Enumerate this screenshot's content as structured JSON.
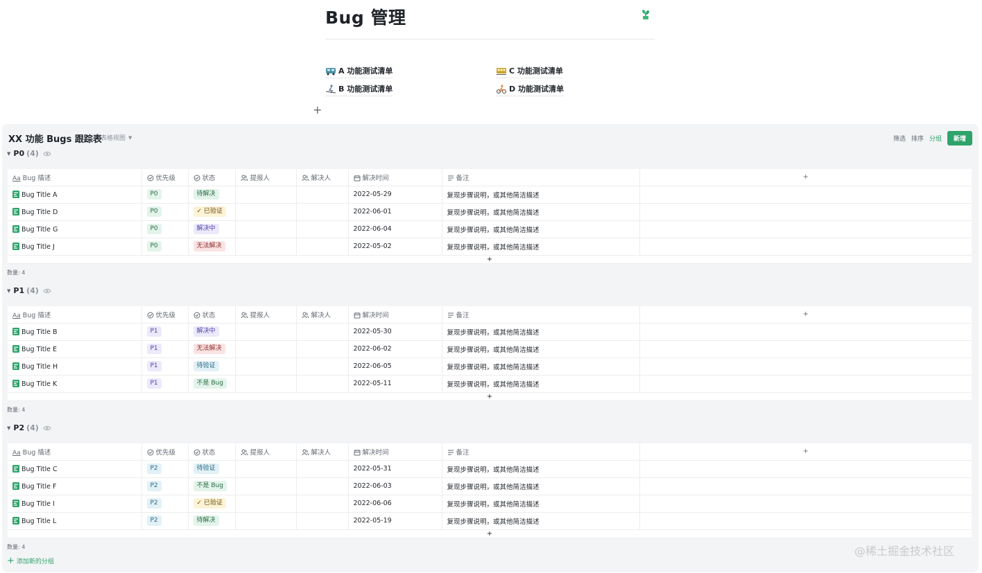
{
  "page": {
    "title": "Bug 管理",
    "links": [
      {
        "label": "A 功能测试清单",
        "emoji_color": "#4a90a4"
      },
      {
        "label": "C 功能测试清单",
        "emoji_color": "#c9a227"
      },
      {
        "label": "B 功能测试清单",
        "emoji_color": "#6a7fa8"
      },
      {
        "label": "D 功能测试清单",
        "emoji_color": "#e07b39"
      }
    ]
  },
  "database": {
    "title": "XX 功能 Bugs 跟踪表",
    "view_label": "表格视图",
    "toolbar": {
      "filter": "筛选",
      "sort": "排序",
      "group": "分组",
      "new": "新增"
    },
    "columns": [
      "Bug 描述",
      "优先级",
      "状态",
      "提报人",
      "解决人",
      "解决时间",
      "备注"
    ],
    "groups": [
      {
        "name": "P0",
        "count": "(4)",
        "count_label": "数量: 4",
        "rows": [
          {
            "title": "Bug Title A",
            "priority": "P0",
            "status": "待解决",
            "date": "2022-05-29",
            "note": "复现步骤说明，或其他简洁描述"
          },
          {
            "title": "Bug Title D",
            "priority": "P0",
            "status": "✓ 已验证",
            "date": "2022-06-01",
            "note": "复现步骤说明，或其他简洁描述"
          },
          {
            "title": "Bug Title G",
            "priority": "P0",
            "status": "解决中",
            "date": "2022-06-04",
            "note": "复现步骤说明，或其他简洁描述"
          },
          {
            "title": "Bug Title J",
            "priority": "P0",
            "status": "无法解决",
            "date": "2022-05-02",
            "note": "复现步骤说明，或其他简洁描述"
          }
        ]
      },
      {
        "name": "P1",
        "count": "(4)",
        "count_label": "数量: 4",
        "rows": [
          {
            "title": "Bug Title B",
            "priority": "P1",
            "status": "解决中",
            "date": "2022-05-30",
            "note": "复现步骤说明，或其他简洁描述"
          },
          {
            "title": "Bug Title E",
            "priority": "P1",
            "status": "无法解决",
            "date": "2022-06-02",
            "note": "复现步骤说明，或其他简洁描述"
          },
          {
            "title": "Bug Title H",
            "priority": "P1",
            "status": "待验证",
            "date": "2022-06-05",
            "note": "复现步骤说明，或其他简洁描述"
          },
          {
            "title": "Bug Title K",
            "priority": "P1",
            "status": "不是 Bug",
            "date": "2022-05-11",
            "note": "复现步骤说明，或其他简洁描述"
          }
        ]
      },
      {
        "name": "P2",
        "count": "(4)",
        "count_label": "数量: 4",
        "rows": [
          {
            "title": "Bug Title C",
            "priority": "P2",
            "status": "待验证",
            "date": "2022-05-31",
            "note": "复现步骤说明，或其他简洁描述"
          },
          {
            "title": "Bug Title F",
            "priority": "P2",
            "status": "不是 Bug",
            "date": "2022-06-03",
            "note": "复现步骤说明，或其他简洁描述"
          },
          {
            "title": "Bug Title I",
            "priority": "P2",
            "status": "✓ 已验证",
            "date": "2022-06-06",
            "note": "复现步骤说明，或其他简洁描述"
          },
          {
            "title": "Bug Title L",
            "priority": "P2",
            "status": "待解决",
            "date": "2022-05-19",
            "note": "复现步骤说明，或其他简洁描述"
          }
        ]
      }
    ],
    "add_group_label": "添加新的分组"
  },
  "colors": {
    "accent": "#2fa36b",
    "priority": {
      "P0": {
        "bg": "#e3f4ea",
        "fg": "#2b6b47"
      },
      "P1": {
        "bg": "#ece9fb",
        "fg": "#4f45a8"
      },
      "P2": {
        "bg": "#e2f1f7",
        "fg": "#2c6a85"
      }
    },
    "status": {
      "待解决": {
        "bg": "#e3f4ea",
        "fg": "#2b6b47"
      },
      "✓ 已验证": {
        "bg": "#fdf3d6",
        "fg": "#6b4e0c"
      },
      "解决中": {
        "bg": "#ece9fb",
        "fg": "#4f45a8"
      },
      "无法解决": {
        "bg": "#fbe3e3",
        "fg": "#8c2f2f"
      },
      "待验证": {
        "bg": "#e2f1f7",
        "fg": "#2c6a85"
      },
      "不是 Bug": {
        "bg": "#e3f4ea",
        "fg": "#2b6b47"
      }
    }
  },
  "icons": [
    "page-plant-icon",
    "text-type-icon",
    "single-select-icon",
    "people-icon",
    "calendar-icon",
    "multiline-text-icon",
    "document-icon",
    "eye-icon",
    "plus-icon"
  ],
  "watermark": "@稀土掘金技术社区"
}
